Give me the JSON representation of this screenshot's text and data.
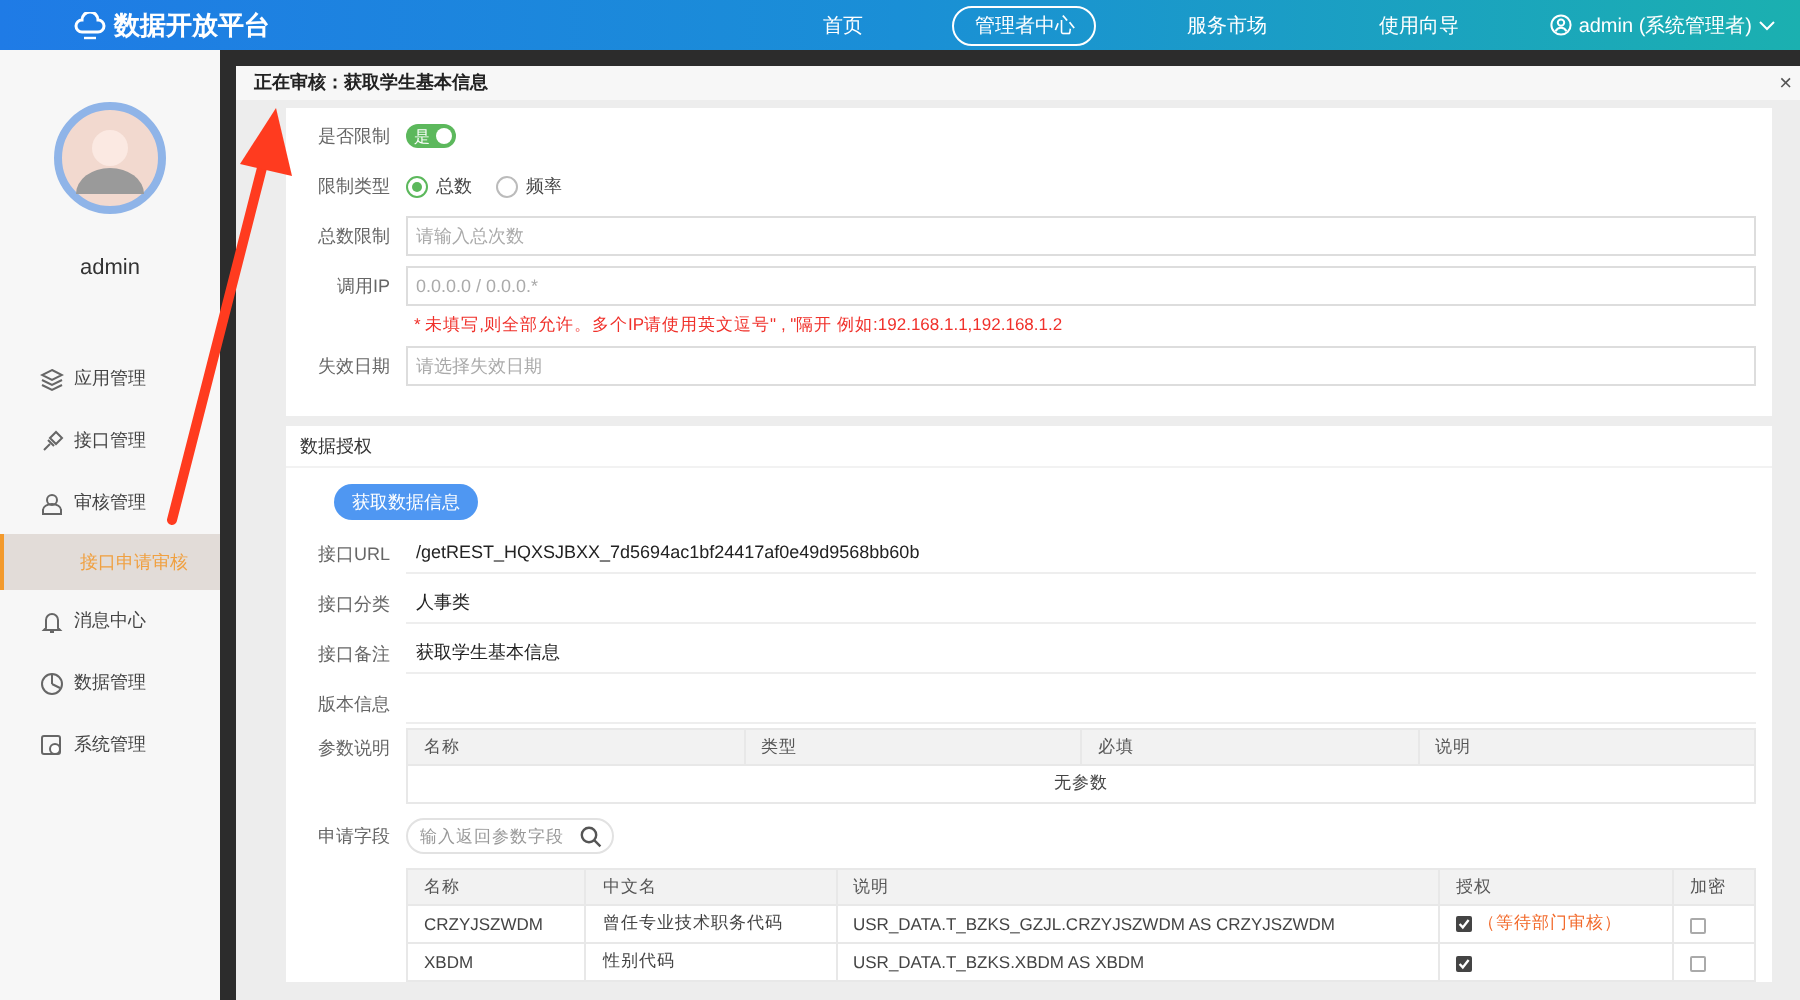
{
  "header": {
    "brand": "数据开放平台",
    "nav": [
      {
        "label": "首页",
        "selected": false
      },
      {
        "label": "管理者中心",
        "selected": true
      },
      {
        "label": "服务市场",
        "selected": false
      },
      {
        "label": "使用向导",
        "selected": false
      }
    ],
    "user": "admin (系统管理者)"
  },
  "sidebar": {
    "username": "admin",
    "items": [
      {
        "label": "应用管理",
        "selected": false
      },
      {
        "label": "接口管理",
        "selected": false
      },
      {
        "label": "审核管理",
        "selected": false,
        "children": [
          {
            "label": "接口申请审核",
            "selected": true
          }
        ]
      },
      {
        "label": "消息中心",
        "selected": false
      },
      {
        "label": "数据管理",
        "selected": false
      },
      {
        "label": "系统管理",
        "selected": false
      }
    ]
  },
  "modal": {
    "title": "正在审核：获取学生基本信息",
    "close": "×",
    "limits": [
      {
        "kind": "toggle",
        "label": "是否限制",
        "on": true,
        "text": "是"
      },
      {
        "kind": "radio",
        "label": "限制类型",
        "options": [
          {
            "label": "总数",
            "selected": true
          },
          {
            "label": "频率",
            "selected": false
          }
        ]
      },
      {
        "kind": "input",
        "label": "总数限制",
        "placeholder": "请输入总次数"
      },
      {
        "kind": "input",
        "label": "调用IP",
        "placeholder": "0.0.0.0 / 0.0.0.*",
        "hint": "*  未填写,则全部允许。多个IP请使用英文逗号\" , \"隔开 例如:192.168.1.1,192.168.1.2"
      },
      {
        "kind": "input",
        "label": "失效日期",
        "placeholder": "请选择失效日期"
      }
    ],
    "auth": {
      "title": "数据授权",
      "button": "获取数据信息",
      "info": [
        {
          "label": "接口URL",
          "value": "/getREST_HQXSJBXX_7d5694ac1bf24417af0e49d9568bb60b"
        },
        {
          "label": "接口分类",
          "value": "人事类"
        },
        {
          "label": "接口备注",
          "value": "获取学生基本信息"
        },
        {
          "label": "版本信息"
        }
      ],
      "params": {
        "label": "参数说明",
        "columns": [
          "名称",
          "类型",
          "必填",
          "说明"
        ],
        "empty": "无参数"
      },
      "fields": {
        "label": "申请字段",
        "placeholder": "输入返回参数字段",
        "columns": [
          "名称",
          "中文名",
          "说明",
          "授权",
          "加密"
        ],
        "rows": [
          {
            "name": "CRZYJSZWDM",
            "cn": "曾任专业技术职务代码",
            "desc": "USR_DATA.T_BZKS_GZJL.CRZYJSZWDM AS CRZYJSZWDM",
            "auth": true,
            "note": "（等待部门审核）",
            "encrypt": false
          },
          {
            "name": "XBDM",
            "cn": "性别代码",
            "desc": "USR_DATA.T_BZKS.XBDM AS XBDM",
            "auth": true,
            "encrypt": false
          }
        ]
      }
    }
  }
}
